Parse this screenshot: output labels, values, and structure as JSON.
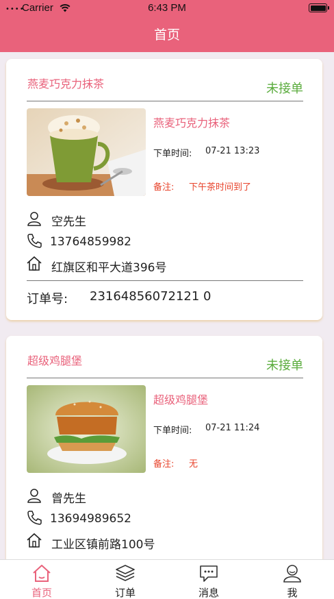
{
  "status_bar": {
    "signal": "••••",
    "carrier": "Carrier",
    "time": "6:43 PM"
  },
  "nav": {
    "title": "首页"
  },
  "orders": [
    {
      "shop_name": "燕麦巧克力抹茶",
      "status": "未接单",
      "product_name": "燕麦巧克力抹茶",
      "order_time_label": "下单时间:",
      "order_time": "07-21 13:23",
      "remark_label": "备注:",
      "remark": "下午茶时间到了",
      "customer": "空先生",
      "phone": "13764859982",
      "address": "红旗区和平大道396号",
      "order_no_label": "订单号:",
      "order_no": "23164856072121 0"
    },
    {
      "shop_name": "超级鸡腿堡",
      "status": "未接单",
      "product_name": "超级鸡腿堡",
      "order_time_label": "下单时间:",
      "order_time": "07-21 11:24",
      "remark_label": "备注:",
      "remark": "无",
      "customer": "曾先生",
      "phone": "13694989652",
      "address": "工业区镇前路100号"
    }
  ],
  "tabbar": {
    "items": [
      {
        "label": "首页",
        "icon": "home-icon",
        "active": true
      },
      {
        "label": "订单",
        "icon": "layers-icon",
        "active": false
      },
      {
        "label": "消息",
        "icon": "message-icon",
        "active": false
      },
      {
        "label": "我",
        "icon": "user-icon",
        "active": false
      }
    ]
  },
  "colors": {
    "brand": "#e9627b",
    "status_green": "#5bac3e",
    "remark_red": "#e8442c",
    "background": "#f1ebf1"
  }
}
